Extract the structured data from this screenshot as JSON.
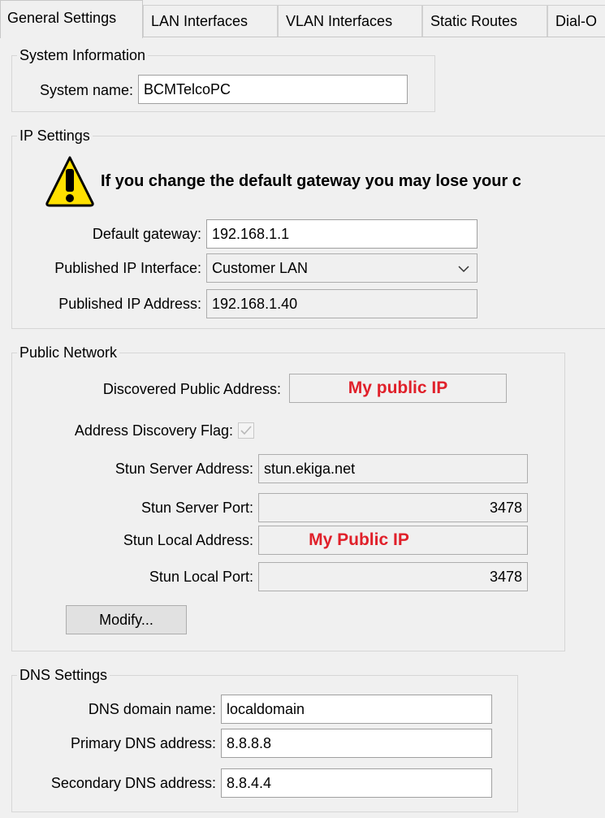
{
  "tabs": [
    {
      "label": "General Settings",
      "active": true
    },
    {
      "label": "LAN Interfaces"
    },
    {
      "label": "VLAN Interfaces"
    },
    {
      "label": "Static Routes"
    },
    {
      "label": "Dial-O"
    }
  ],
  "system_info": {
    "legend": "System Information",
    "system_name_label": "System name:",
    "system_name_value": "BCMTelcoPC"
  },
  "ip_settings": {
    "legend": "IP Settings",
    "warning_icon": "warning-icon",
    "warning_text": "If you change the default gateway you may lose your c",
    "default_gateway_label": "Default gateway:",
    "default_gateway_value": "192.168.1.1",
    "published_interface_label": "Published IP Interface:",
    "published_interface_value": "Customer LAN",
    "published_address_label": "Published IP Address:",
    "published_address_value": "192.168.1.40"
  },
  "public_network": {
    "legend": "Public Network",
    "discovered_label": "Discovered Public Address:",
    "discovered_value": "My public IP",
    "discovery_flag_label": "Address Discovery Flag:",
    "discovery_flag_checked": true,
    "stun_server_address_label": "Stun Server Address:",
    "stun_server_address_value": "stun.ekiga.net",
    "stun_server_port_label": "Stun Server Port:",
    "stun_server_port_value": "3478",
    "stun_local_address_label": "Stun Local Address:",
    "stun_local_address_value": "My Public IP",
    "stun_local_port_label": "Stun Local Port:",
    "stun_local_port_value": "3478",
    "modify_label": "Modify..."
  },
  "dns_settings": {
    "legend": "DNS Settings",
    "domain_label": "DNS domain name:",
    "domain_value": "localdomain",
    "primary_label": "Primary DNS address:",
    "primary_value": "8.8.8.8",
    "secondary_label": "Secondary DNS address:",
    "secondary_value": "8.8.4.4"
  },
  "colors": {
    "highlight_text": "#e0202a",
    "background": "#f0f0f0",
    "warning_yellow": "#ffe000"
  }
}
